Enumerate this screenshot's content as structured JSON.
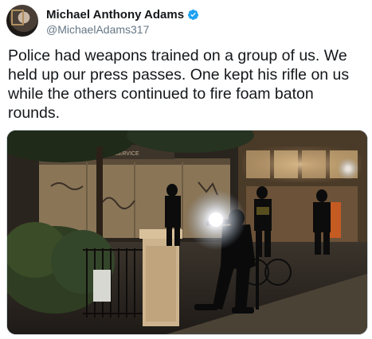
{
  "author": {
    "name": "Michael Anthony Adams",
    "handle": "@MichaelAdams317",
    "verified": true
  },
  "tweet": {
    "text": "Police had weapons trained on a group of us. We held up our press passes. One kept his rifle on us while the others continued to fire foam baton rounds."
  },
  "media": {
    "sign_text": "TAX SERVICE"
  },
  "colors": {
    "verified_badge": "#1da1f2",
    "handle": "#657786",
    "text": "#14171a"
  },
  "icons": [
    "verified-badge-icon"
  ]
}
